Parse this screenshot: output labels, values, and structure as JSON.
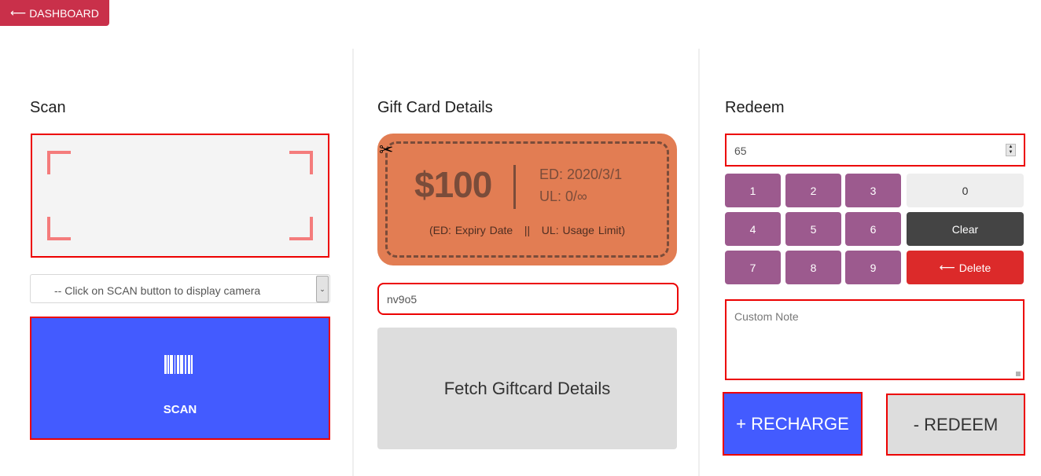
{
  "nav": {
    "back_arrow": "⟵",
    "dashboard_label": "DASHBOARD"
  },
  "scan": {
    "heading": "Scan",
    "camera_select_value": "-- Click on SCAN button to display camera",
    "select_arrow": "⌄",
    "scan_button_label": "SCAN",
    "scan_icon": "barcode-icon"
  },
  "giftcard": {
    "heading": "Gift Card Details",
    "scissors_icon": "✂",
    "amount": "$100",
    "expiry": "ED: 2020/3/1",
    "usage": "UL: 0/∞",
    "legend": "(ED: Expiry Date   ||   UL: Usage Limit)",
    "code_value": "nv9o5",
    "fetch_button_label": "Fetch Giftcard Details"
  },
  "redeem": {
    "heading": "Redeem",
    "amount_value": "65",
    "keypad": {
      "digits": [
        "1",
        "2",
        "3",
        "4",
        "5",
        "6",
        "7",
        "8",
        "9"
      ],
      "zero": "0",
      "clear": "Clear",
      "delete_arrow": "⟵",
      "delete": "Delete"
    },
    "note_placeholder": "Custom Note",
    "recharge_label": "+ RECHARGE",
    "redeem_label": "- REDEEM"
  },
  "colors": {
    "accent_blue": "#435bff",
    "dashboard_red": "#c9304a",
    "keypad_purple": "#9c5a8e",
    "giftcard_orange": "#e27d53",
    "delete_red": "#dc2a2a",
    "highlight_border": "#ec0000"
  }
}
